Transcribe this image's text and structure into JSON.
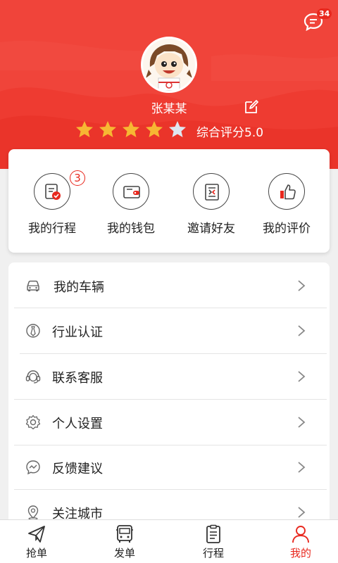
{
  "header": {
    "message_badge": "34",
    "username": "张某某",
    "rating_label": "综合评分5.0",
    "rating": {
      "filled": 4,
      "total": 5
    }
  },
  "quick_actions": [
    {
      "label": "我的行程",
      "icon": "itinerary-icon",
      "badge": "3"
    },
    {
      "label": "我的钱包",
      "icon": "wallet-icon"
    },
    {
      "label": "邀请好友",
      "icon": "invite-icon"
    },
    {
      "label": "我的评价",
      "icon": "thumbs-up-icon"
    }
  ],
  "menu": [
    {
      "label": "我的车辆",
      "icon": "car-icon"
    },
    {
      "label": "行业认证",
      "icon": "tie-icon"
    },
    {
      "label": "联系客服",
      "icon": "headset-icon"
    },
    {
      "label": "个人设置",
      "icon": "gear-icon"
    },
    {
      "label": "反馈建议",
      "icon": "feedback-icon"
    },
    {
      "label": "关注城市",
      "icon": "location-icon"
    }
  ],
  "tabs": [
    {
      "label": "抢单",
      "icon": "paper-plane-icon"
    },
    {
      "label": "发单",
      "icon": "bus-icon"
    },
    {
      "label": "行程",
      "icon": "clipboard-icon"
    },
    {
      "label": "我的",
      "icon": "user-icon",
      "active": true
    }
  ],
  "colors": {
    "brand_red": "#f0443a",
    "accent_red": "#e8281e",
    "star_gold": "#f7b733"
  }
}
